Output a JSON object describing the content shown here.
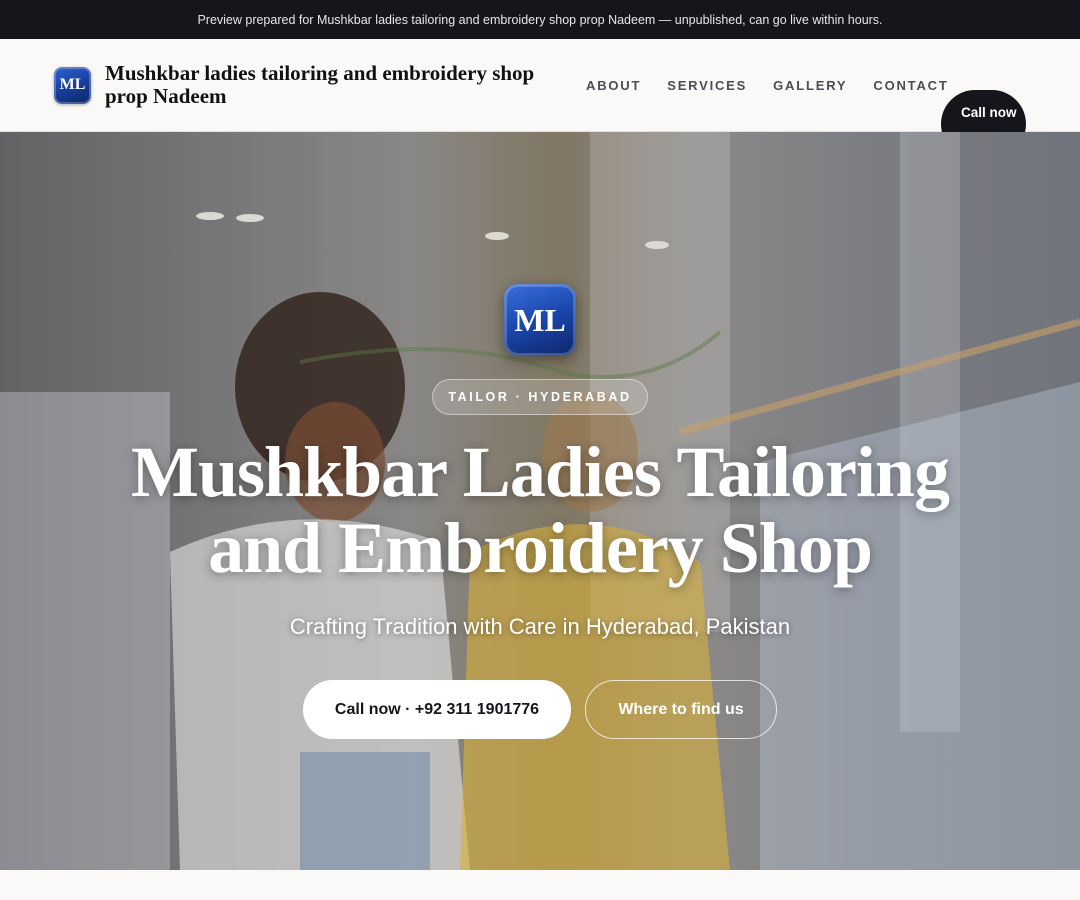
{
  "preview_banner": "Preview prepared for Mushkbar ladies tailoring and embroidery shop prop Nadeem — unpublished, can go live within hours.",
  "header": {
    "logo_initials": "ML",
    "brand_name": "Mushkbar ladies tailoring and embroidery shop prop Nadeem",
    "nav": [
      "ABOUT",
      "SERVICES",
      "GALLERY",
      "CONTACT"
    ],
    "call_button": "Call now"
  },
  "hero": {
    "logo_initials": "ML",
    "tag": "TAILOR · HYDERABAD",
    "title_line1": "Mushkbar Ladies Tailoring",
    "title_line2": "and Embroidery Shop",
    "subtitle": "Crafting Tradition with Care in Hyderabad, Pakistan",
    "primary_button": "Call now · +92 311 1901776",
    "secondary_button": "Where to find us"
  },
  "colors": {
    "dark": "#14161b",
    "brand_blue": "#1a46aa",
    "page_bg": "#faf9f7"
  }
}
